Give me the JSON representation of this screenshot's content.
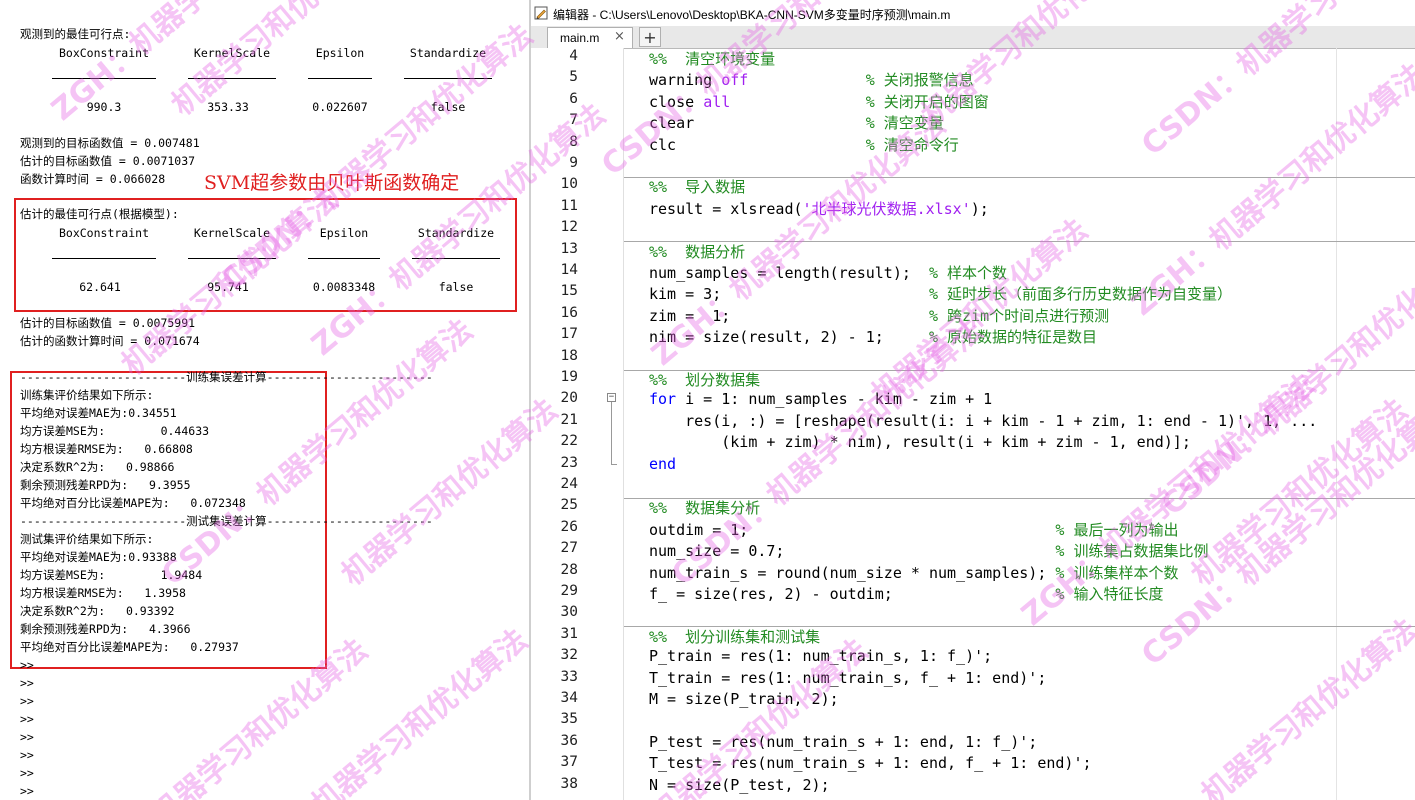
{
  "command_window": {
    "observed_best_label": "观测到的最佳可行点:",
    "param_headers": [
      "BoxConstraint",
      "KernelScale",
      "Epsilon",
      "Standardize"
    ],
    "observed_values": [
      "990.3",
      "353.33",
      "0.022607",
      "false"
    ],
    "observed_objective": "观测到的目标函数值 = 0.007481",
    "estimated_objective_1": "估计的目标函数值 = 0.0071037",
    "function_time": "函数计算时间 = 0.066028",
    "annotation": "SVM超参数由贝叶斯函数确定",
    "estimated_best_label": "估计的最佳可行点(根据模型):",
    "estimated_values": [
      "62.641",
      "95.741",
      "0.0083348",
      "false"
    ],
    "estimated_objective_2": "估计的目标函数值 = 0.0075991",
    "estimated_function_time": "估计的函数计算时间 = 0.071674",
    "train_separator": "------------------------训练集误差计算------------------------",
    "train_lines": [
      "训练集评价结果如下所示:",
      "平均绝对误差MAE为:0.34551",
      "均方误差MSE为:        0.44633",
      "均方根误差RMSE为:   0.66808",
      "决定系数R^2为:   0.98866",
      "剩余预测残差RPD为:   9.3955",
      "平均绝对百分比误差MAPE为:   0.072348"
    ],
    "test_separator": "------------------------测试集误差计算------------------------",
    "test_lines": [
      "测试集评价结果如下所示:",
      "平均绝对误差MAE为:0.93388",
      "均方误差MSE为:        1.9484",
      "均方根误差RMSE为:   1.3958",
      "决定系数R^2为:   0.93392",
      "剩余预测残差RPD为:   4.3966",
      "平均绝对百分比误差MAPE为:   0.27937"
    ],
    "prompt": ">>"
  },
  "editor": {
    "title": "编辑器 - C:\\Users\\Lenovo\\Desktop\\BKA-CNN-SVM多变量时序预测\\main.m",
    "tab_label": "main.m",
    "tab_close": "×",
    "tab_add": "+",
    "lines": [
      {
        "n": "4",
        "segs": [
          {
            "t": "%%  清空环境变量",
            "c": "cm"
          }
        ]
      },
      {
        "n": "5",
        "segs": [
          {
            "t": "warning ",
            "c": ""
          },
          {
            "t": "off",
            "c": "str"
          },
          {
            "t": "             ",
            "c": ""
          },
          {
            "t": "% 关闭报警信息",
            "c": "cm"
          }
        ]
      },
      {
        "n": "6",
        "segs": [
          {
            "t": "close ",
            "c": ""
          },
          {
            "t": "all",
            "c": "str"
          },
          {
            "t": "               ",
            "c": ""
          },
          {
            "t": "% 关闭开启的图窗",
            "c": "cm"
          }
        ]
      },
      {
        "n": "7",
        "segs": [
          {
            "t": "clear                   ",
            "c": ""
          },
          {
            "t": "% 清空变量",
            "c": "cm"
          }
        ]
      },
      {
        "n": "8",
        "segs": [
          {
            "t": "clc                     ",
            "c": ""
          },
          {
            "t": "% 清空命令行",
            "c": "cm"
          }
        ]
      },
      {
        "n": "9",
        "segs": []
      },
      {
        "n": "10",
        "segs": [
          {
            "t": "%%  导入数据",
            "c": "cm"
          }
        ]
      },
      {
        "n": "11",
        "segs": [
          {
            "t": "result = xlsread(",
            "c": ""
          },
          {
            "t": "'北半球光伏数据.xlsx'",
            "c": "str"
          },
          {
            "t": ");",
            "c": ""
          }
        ]
      },
      {
        "n": "12",
        "segs": []
      },
      {
        "n": "13",
        "segs": [
          {
            "t": "%%  数据分析",
            "c": "cm"
          }
        ]
      },
      {
        "n": "14",
        "segs": [
          {
            "t": "num_samples = length(result);  ",
            "c": ""
          },
          {
            "t": "% 样本个数",
            "c": "cm"
          }
        ]
      },
      {
        "n": "15",
        "segs": [
          {
            "t": "kim = 3;                       ",
            "c": ""
          },
          {
            "t": "% 延时步长（前面多行历史数据作为自变量）",
            "c": "cm"
          }
        ]
      },
      {
        "n": "16",
        "segs": [
          {
            "t": "zim =  1;                      ",
            "c": ""
          },
          {
            "t": "% 跨zim个时间点进行预测",
            "c": "cm"
          }
        ]
      },
      {
        "n": "17",
        "segs": [
          {
            "t": "nim = size(result, 2) - 1;     ",
            "c": ""
          },
          {
            "t": "% 原始数据的特征是数目",
            "c": "cm"
          }
        ]
      },
      {
        "n": "18",
        "segs": []
      },
      {
        "n": "19",
        "segs": [
          {
            "t": "%%  划分数据集",
            "c": "cm"
          }
        ]
      },
      {
        "n": "20",
        "segs": [
          {
            "t": "for",
            "c": "kw"
          },
          {
            "t": " i = 1: num_samples - kim - zim + 1",
            "c": ""
          }
        ]
      },
      {
        "n": "21",
        "segs": [
          {
            "t": "    res(i, :) = [reshape(result(i: i + kim - 1 + zim, 1: end - 1)', 1, ...",
            "c": ""
          }
        ]
      },
      {
        "n": "22",
        "segs": [
          {
            "t": "        (kim + zim) * nim), result(i + kim + zim - 1, end)];",
            "c": ""
          }
        ]
      },
      {
        "n": "23",
        "segs": [
          {
            "t": "end",
            "c": "kw"
          }
        ]
      },
      {
        "n": "24",
        "segs": []
      },
      {
        "n": "25",
        "segs": [
          {
            "t": "%%  数据集分析",
            "c": "cm"
          }
        ]
      },
      {
        "n": "26",
        "segs": [
          {
            "t": "outdim = 1;                                  ",
            "c": ""
          },
          {
            "t": "% 最后一列为输出",
            "c": "cm"
          }
        ]
      },
      {
        "n": "27",
        "segs": [
          {
            "t": "num_size = 0.7;                              ",
            "c": ""
          },
          {
            "t": "% 训练集占数据集比例",
            "c": "cm"
          }
        ]
      },
      {
        "n": "28",
        "segs": [
          {
            "t": "num_train_s = round(num_size * num_samples); ",
            "c": ""
          },
          {
            "t": "% 训练集样本个数",
            "c": "cm"
          }
        ]
      },
      {
        "n": "29",
        "segs": [
          {
            "t": "f_ = size(res, 2) - outdim;                  ",
            "c": ""
          },
          {
            "t": "% 输入特征长度",
            "c": "cm"
          }
        ]
      },
      {
        "n": "30",
        "segs": []
      },
      {
        "n": "31",
        "segs": [
          {
            "t": "%%  划分训练集和测试集",
            "c": "cm"
          }
        ]
      },
      {
        "n": "32",
        "segs": [
          {
            "t": "P_train = res(1: num_train_s, 1: f_)';",
            "c": ""
          }
        ]
      },
      {
        "n": "33",
        "segs": [
          {
            "t": "T_train = res(1: num_train_s, f_ + 1: end)';",
            "c": ""
          }
        ]
      },
      {
        "n": "34",
        "segs": [
          {
            "t": "M = size(P_train, 2);",
            "c": ""
          }
        ]
      },
      {
        "n": "35",
        "segs": []
      },
      {
        "n": "36",
        "segs": [
          {
            "t": "P_test = res(num_train_s + 1: end, 1: f_)';",
            "c": ""
          }
        ]
      },
      {
        "n": "37",
        "segs": [
          {
            "t": "T_test = res(num_train_s + 1: end, f_ + 1: end)';",
            "c": ""
          }
        ]
      },
      {
        "n": "38",
        "segs": [
          {
            "t": "N = size(P_test, 2);",
            "c": ""
          }
        ]
      }
    ]
  },
  "watermark": {
    "texts": [
      "ZGH：机器学习和优化算法",
      "CSDN：机器学习和优化算法",
      "机器学习和优化算法"
    ],
    "color": "#e664e6"
  },
  "colors": {
    "keyword": "#0000ff",
    "string": "#a020f0",
    "comment": "#228b22",
    "annotation_red": "#e02020"
  }
}
